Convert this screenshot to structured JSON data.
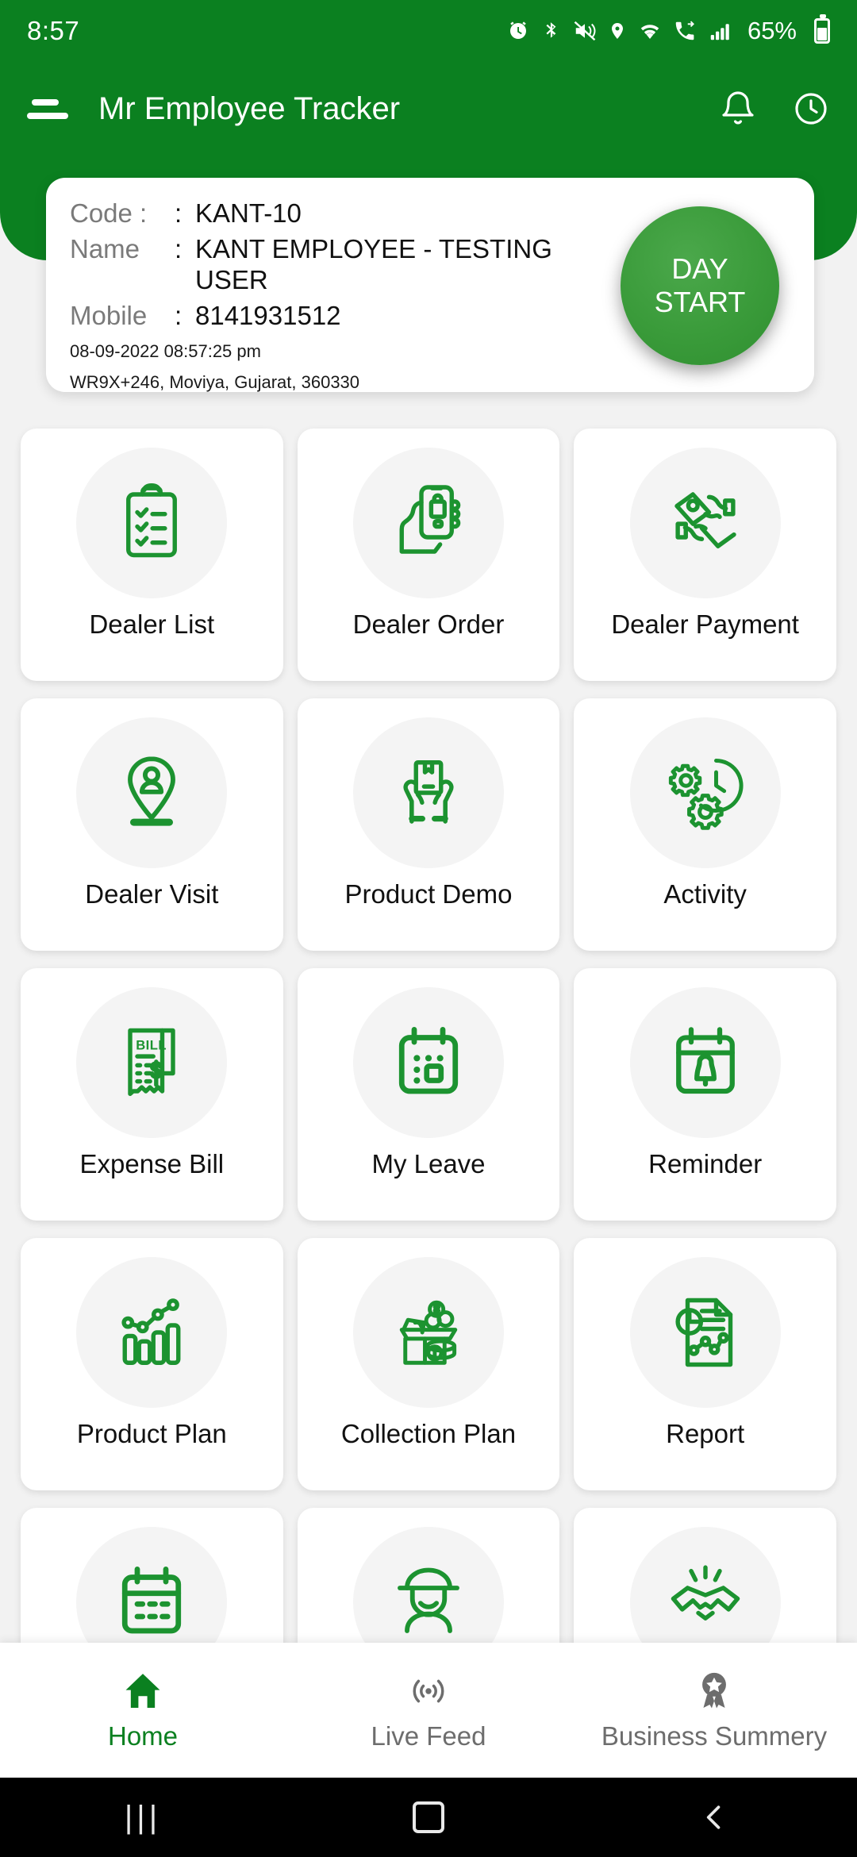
{
  "status_bar": {
    "time": "8:57",
    "battery_percent": "65%",
    "icons": [
      "alarm-icon",
      "bluetooth-icon",
      "mute-icon",
      "location-icon",
      "wifi-icon",
      "call-forward-icon",
      "signal-icon"
    ]
  },
  "app_bar": {
    "title": "Mr Employee Tracker",
    "menu_icon": "menu-icon",
    "actions": [
      "bell-icon",
      "history-icon"
    ]
  },
  "info_card": {
    "rows": [
      {
        "label": "Code :",
        "separator": ":",
        "value": "KANT-10"
      },
      {
        "label": "Name",
        "separator": ":",
        "value": "KANT EMPLOYEE - TESTING USER"
      },
      {
        "label": "Mobile",
        "separator": ":",
        "value": "8141931512"
      }
    ],
    "timestamp": "08-09-2022 08:57:25 pm",
    "address": "WR9X+246, Moviya, Gujarat, 360330",
    "day_button": {
      "line1": "DAY",
      "line2": "START"
    }
  },
  "grid": {
    "items": [
      {
        "label": "Dealer List",
        "icon": "clipboard-checklist-icon"
      },
      {
        "label": "Dealer Order",
        "icon": "hand-phone-order-icon"
      },
      {
        "label": "Dealer Payment",
        "icon": "hands-cash-exchange-icon"
      },
      {
        "label": "Dealer Visit",
        "icon": "map-pin-person-icon"
      },
      {
        "label": "Product Demo",
        "icon": "hands-box-icon"
      },
      {
        "label": "Activity",
        "icon": "gears-clock-icon"
      },
      {
        "label": "Expense Bill",
        "icon": "bill-receipt-icon"
      },
      {
        "label": "My Leave",
        "icon": "calendar-icon"
      },
      {
        "label": "Reminder",
        "icon": "calendar-bell-icon"
      },
      {
        "label": "Product Plan",
        "icon": "bar-line-chart-icon"
      },
      {
        "label": "Collection Plan",
        "icon": "money-box-icon"
      },
      {
        "label": "Report",
        "icon": "report-document-icon"
      },
      {
        "label": "",
        "icon": "calendar-grid-icon"
      },
      {
        "label": "",
        "icon": "person-hat-icon"
      },
      {
        "label": "",
        "icon": "handshake-icon"
      }
    ]
  },
  "bottom_nav": {
    "items": [
      {
        "label": "Home",
        "icon": "home-icon",
        "active": true
      },
      {
        "label": "Live Feed",
        "icon": "broadcast-icon",
        "active": false
      },
      {
        "label": "Business Summery",
        "icon": "award-badge-icon",
        "active": false
      }
    ]
  },
  "system_nav": {
    "recent_glyph": "|||",
    "home": "home-square-icon",
    "back": "back-chevron-icon"
  },
  "colors": {
    "brand_green": "#0b8020",
    "icon_green": "#1c9330",
    "day_button_green": "#3a9b3a",
    "card_white": "#ffffff",
    "page_bg": "#f2f2f2",
    "label_grey": "#7a7a7a",
    "nav_inactive": "#6d6d6d"
  }
}
